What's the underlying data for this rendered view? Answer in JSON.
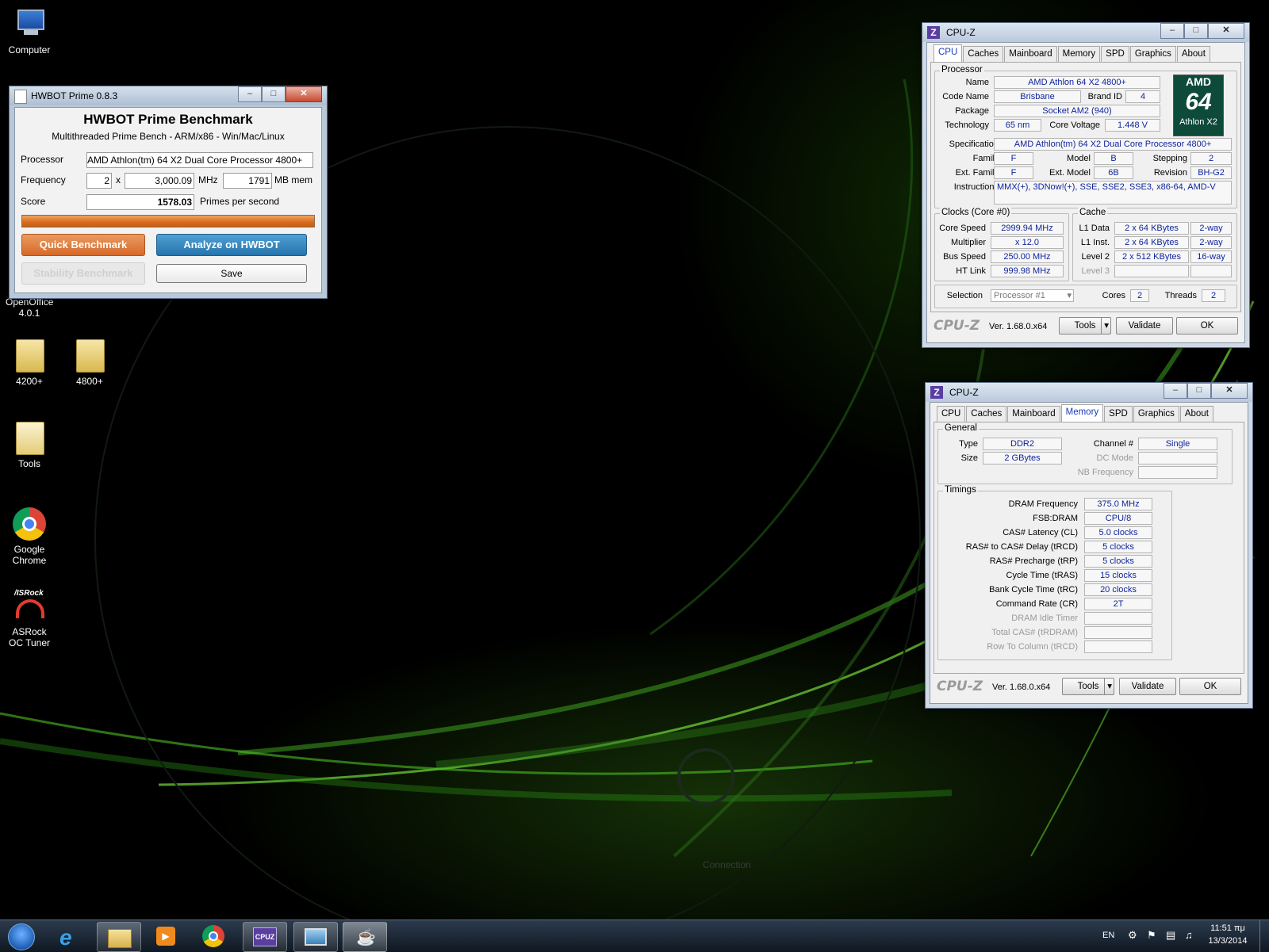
{
  "desktop": {
    "icons": [
      {
        "label": "Computer"
      },
      {
        "label": "OpenOffice 4.0.1"
      },
      {
        "label": "4200+"
      },
      {
        "label": "4800+"
      },
      {
        "label": "Tools"
      },
      {
        "label": "Google Chrome"
      },
      {
        "label": "ASRock OC Tuner"
      }
    ],
    "wallpaper_watermark": "Connection",
    "asrock_logo": "/ISRock"
  },
  "hwbot": {
    "title": "HWBOT Prime 0.8.3",
    "heading": "HWBOT Prime Benchmark",
    "subheading": "Multithreaded Prime Bench - ARM/x86 - Win/Mac/Linux",
    "processor_label": "Processor",
    "processor_value": "AMD Athlon(tm) 64 X2 Dual Core Processor 4800+",
    "frequency_label": "Frequency",
    "cores": "2",
    "x": "x",
    "mhz_value": "3,000.09",
    "mhz_unit": "MHz",
    "mem_value": "1791",
    "mem_unit": "MB mem",
    "score_label": "Score",
    "score_value": "1578.03",
    "score_unit": "Primes per second",
    "progress": 1.0,
    "btn_quick": "Quick Benchmark",
    "btn_analyze": "Analyze on HWBOT",
    "btn_stability": "Stability Benchmark",
    "btn_save": "Save",
    "colors": {
      "orange": "#e07a2c",
      "blue": "#2f7fb8"
    }
  },
  "cpuz_cpu": {
    "title": "CPU-Z",
    "tabs": [
      "CPU",
      "Caches",
      "Mainboard",
      "Memory",
      "SPD",
      "Graphics",
      "About"
    ],
    "active_tab": "CPU",
    "processor_group": "Processor",
    "name_label": "Name",
    "name": "AMD Athlon 64 X2 4800+",
    "codename_label": "Code Name",
    "codename": "Brisbane",
    "brandid_label": "Brand ID",
    "brandid": "4",
    "package_label": "Package",
    "package": "Socket AM2 (940)",
    "technology_label": "Technology",
    "technology": "65 nm",
    "voltage_label": "Core Voltage",
    "voltage": "1.448 V",
    "spec_label": "Specification",
    "spec": "AMD Athlon(tm) 64 X2 Dual Core Processor 4800+",
    "family_label": "Family",
    "family": "F",
    "model_label": "Model",
    "model": "B",
    "stepping_label": "Stepping",
    "stepping": "2",
    "extfamily_label": "Ext. Family",
    "extfamily": "F",
    "extmodel_label": "Ext. Model",
    "extmodel": "6B",
    "revision_label": "Revision",
    "revision": "BH-G2",
    "instructions_label": "Instructions",
    "instructions": "MMX(+), 3DNow!(+), SSE, SSE2, SSE3, x86-64, AMD-V",
    "logo": {
      "brand": "AMD",
      "number": "64",
      "line": "Athlon X2"
    },
    "clocks_group": "Clocks (Core #0)",
    "corespeed_label": "Core Speed",
    "corespeed": "2999.94 MHz",
    "multiplier_label": "Multiplier",
    "multiplier": "x 12.0",
    "busspeed_label": "Bus Speed",
    "busspeed": "250.00 MHz",
    "htlink_label": "HT Link",
    "htlink": "999.98 MHz",
    "cache_group": "Cache",
    "l1data_label": "L1 Data",
    "l1data": "2 x 64 KBytes",
    "l1data_way": "2-way",
    "l1inst_label": "L1 Inst.",
    "l1inst": "2 x 64 KBytes",
    "l1inst_way": "2-way",
    "level2_label": "Level 2",
    "level2": "2 x 512 KBytes",
    "level2_way": "16-way",
    "level3_label": "Level 3",
    "selection_label": "Selection",
    "selection": "Processor #1",
    "cores_label": "Cores",
    "cores": "2",
    "threads_label": "Threads",
    "threads": "2",
    "footer_logo": "CPU-Z",
    "version": "Ver. 1.68.0.x64",
    "tools": "Tools",
    "validate": "Validate",
    "ok": "OK"
  },
  "cpuz_mem": {
    "title": "CPU-Z",
    "tabs": [
      "CPU",
      "Caches",
      "Mainboard",
      "Memory",
      "SPD",
      "Graphics",
      "About"
    ],
    "active_tab": "Memory",
    "general_group": "General",
    "type_label": "Type",
    "type": "DDR2",
    "size_label": "Size",
    "size": "2 GBytes",
    "channel_label": "Channel #",
    "channel": "Single",
    "dcmode_label": "DC Mode",
    "nbfreq_label": "NB Frequency",
    "timings_group": "Timings",
    "timings": [
      {
        "label": "DRAM Frequency",
        "value": "375.0 MHz",
        "dim": false
      },
      {
        "label": "FSB:DRAM",
        "value": "CPU/8",
        "dim": false
      },
      {
        "label": "CAS# Latency (CL)",
        "value": "5.0 clocks",
        "dim": false
      },
      {
        "label": "RAS# to CAS# Delay (tRCD)",
        "value": "5 clocks",
        "dim": false
      },
      {
        "label": "RAS# Precharge (tRP)",
        "value": "5 clocks",
        "dim": false
      },
      {
        "label": "Cycle Time (tRAS)",
        "value": "15 clocks",
        "dim": false
      },
      {
        "label": "Bank Cycle Time (tRC)",
        "value": "20 clocks",
        "dim": false
      },
      {
        "label": "Command Rate (CR)",
        "value": "2T",
        "dim": false
      },
      {
        "label": "DRAM Idle Timer",
        "value": "",
        "dim": true
      },
      {
        "label": "Total CAS# (tRDRAM)",
        "value": "",
        "dim": true
      },
      {
        "label": "Row To Column (tRCD)",
        "value": "",
        "dim": true
      }
    ],
    "footer_logo": "CPU-Z",
    "version": "Ver. 1.68.0.x64",
    "tools": "Tools",
    "validate": "Validate",
    "ok": "OK"
  },
  "taskbar": {
    "items": [
      "start",
      "internet-explorer",
      "explorer",
      "media-player",
      "chrome",
      "cpu-z",
      "photo-viewer",
      "java"
    ],
    "cpuz_icon_text": "CPUZ",
    "language": "EN",
    "time": "11:51 πμ",
    "date": "13/3/2014"
  }
}
